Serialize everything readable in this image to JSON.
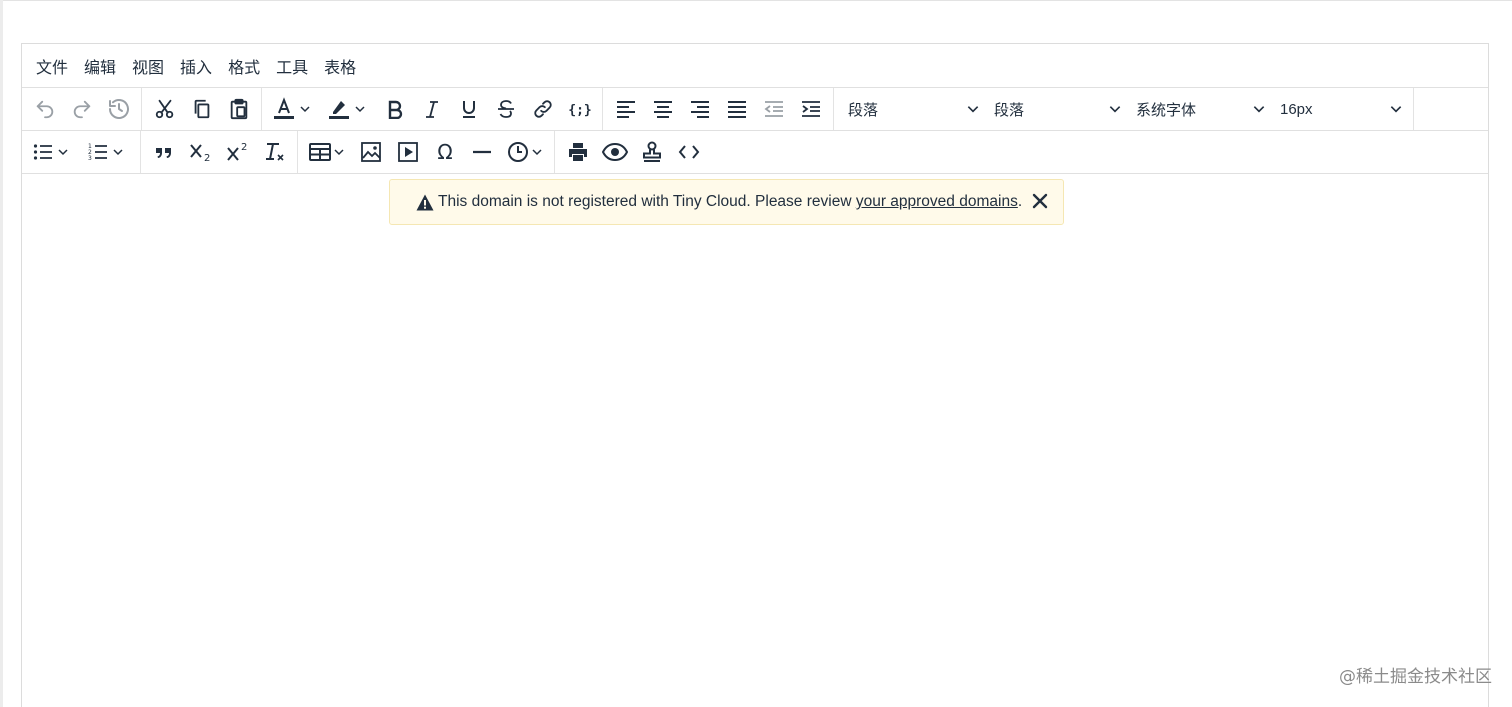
{
  "menubar": {
    "items": [
      "文件",
      "编辑",
      "视图",
      "插入",
      "格式",
      "工具",
      "表格"
    ]
  },
  "toolbar": {
    "row1": {
      "history": [
        "undo-icon",
        "redo-icon",
        "restore-draft-icon"
      ],
      "clipboard": [
        "cut-icon",
        "copy-icon",
        "paste-icon"
      ],
      "formatting": [
        "text-color-icon",
        "highlight-color-icon",
        "bold-icon",
        "italic-icon",
        "underline-icon",
        "strikethrough-icon",
        "link-icon",
        "code-sample-icon"
      ],
      "alignment": [
        "align-left-icon",
        "align-center-icon",
        "align-right-icon",
        "align-justify-icon",
        "outdent-icon",
        "indent-icon"
      ],
      "selects": {
        "blocks": "段落",
        "line_format": "段落",
        "font_family": "系统字体",
        "font_size": "16px"
      }
    },
    "row2": {
      "lists": [
        "bullet-list-icon",
        "numbered-list-icon"
      ],
      "script": [
        "blockquote-icon",
        "subscript-icon",
        "superscript-icon",
        "remove-format-icon"
      ],
      "insert": [
        "table-icon",
        "image-icon",
        "media-icon",
        "special-char-icon",
        "horizontal-rule-icon",
        "insert-datetime-icon"
      ],
      "misc": [
        "print-icon",
        "preview-icon",
        "template-icon",
        "source-code-icon"
      ]
    }
  },
  "notification": {
    "text": "This domain is not registered with Tiny Cloud. Please review ",
    "link_text": "your approved domains",
    "suffix": ".",
    "accent_color": "#fffaea"
  },
  "watermark": "@稀土掘金技术社区"
}
